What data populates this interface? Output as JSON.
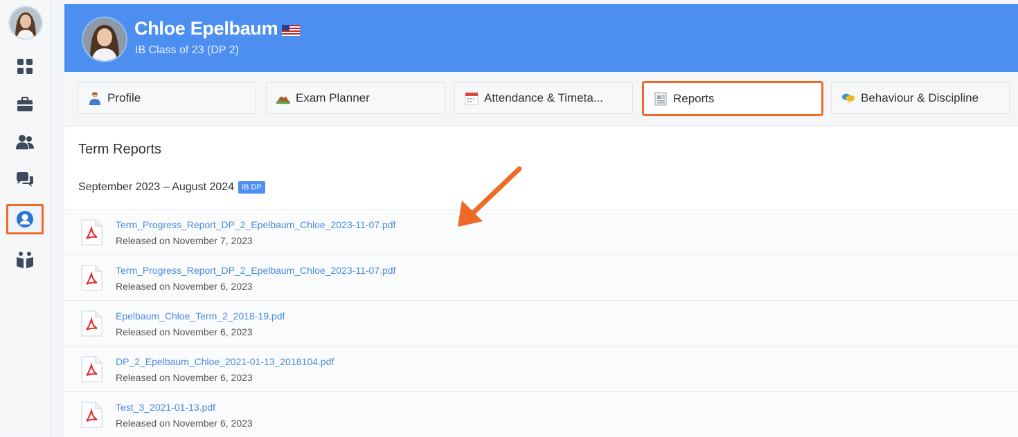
{
  "student": {
    "name": "Chloe Epelbaum",
    "class": "IB Class of 23 (DP 2)"
  },
  "rail": {
    "icons": [
      "avatar",
      "dashboard-icon",
      "briefcase-icon",
      "users-icon",
      "chat-icon",
      "profile-icon",
      "family-icon"
    ],
    "active": "profile-icon"
  },
  "tabs": [
    {
      "label": "Profile",
      "icon": "profile-tab-icon"
    },
    {
      "label": "Exam Planner",
      "icon": "exam-planner-icon"
    },
    {
      "label": "Attendance & Timeta...",
      "icon": "calendar-icon"
    },
    {
      "label": "Reports",
      "icon": "reports-icon",
      "active": true
    },
    {
      "label": "Behaviour & Discipline",
      "icon": "speech-bubbles-icon"
    }
  ],
  "section": {
    "title": "Term Reports",
    "period": "September 2023 – August 2024",
    "badge": "IB DP"
  },
  "reports": [
    {
      "file": "Term_Progress_Report_DP_2_Epelbaum_Chloe_2023-11-07.pdf",
      "released": "Released on November 7, 2023"
    },
    {
      "file": "Term_Progress_Report_DP_2_Epelbaum_Chloe_2023-11-07.pdf",
      "released": "Released on November 6, 2023"
    },
    {
      "file": "Epelbaum_Chloe_Term_2_2018-19.pdf",
      "released": "Released on November 6, 2023"
    },
    {
      "file": "DP_2_Epelbaum_Chloe_2021-01-13_2018104.pdf",
      "released": "Released on November 6, 2023"
    },
    {
      "file": "Test_3_2021-01-13.pdf",
      "released": "Released on November 6, 2023"
    }
  ],
  "colors": {
    "banner": "#4d8ff0",
    "highlight": "#ee6a26",
    "link": "#4a8ae0"
  }
}
